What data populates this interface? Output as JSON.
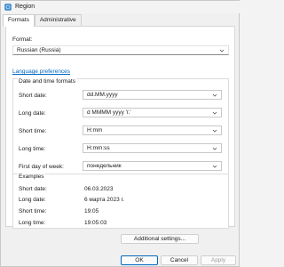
{
  "window": {
    "title": "Region"
  },
  "tabs": [
    {
      "label": "Formats"
    },
    {
      "label": "Administrative"
    }
  ],
  "format": {
    "label": "Format:",
    "value": "Russian (Russia)"
  },
  "language_link": "Language preferences",
  "date_time_group": {
    "title": "Date and time formats",
    "rows": [
      {
        "label": "Short date:",
        "value": "dd.MM.yyyy"
      },
      {
        "label": "Long date:",
        "value": "d MMMM yyyy 'г.'"
      },
      {
        "label": "Short time:",
        "value": "H:mm"
      },
      {
        "label": "Long time:",
        "value": "H:mm:ss"
      },
      {
        "label": "First day of week:",
        "value": "понедельник"
      }
    ]
  },
  "examples_group": {
    "title": "Examples",
    "rows": [
      {
        "label": "Short date:",
        "value": "06.03.2023"
      },
      {
        "label": "Long date:",
        "value": "6 марта 2023 г."
      },
      {
        "label": "Short time:",
        "value": "19:05"
      },
      {
        "label": "Long time:",
        "value": "19:05:03"
      }
    ]
  },
  "buttons": {
    "additional": "Additional settings...",
    "ok": "OK",
    "cancel": "Cancel",
    "apply": "Apply"
  },
  "colors": {
    "link": "#0067c0",
    "accent": "#0067c0"
  },
  "icons": {
    "app": "region-globe-icon",
    "dropdown": "chevron-down-icon"
  }
}
